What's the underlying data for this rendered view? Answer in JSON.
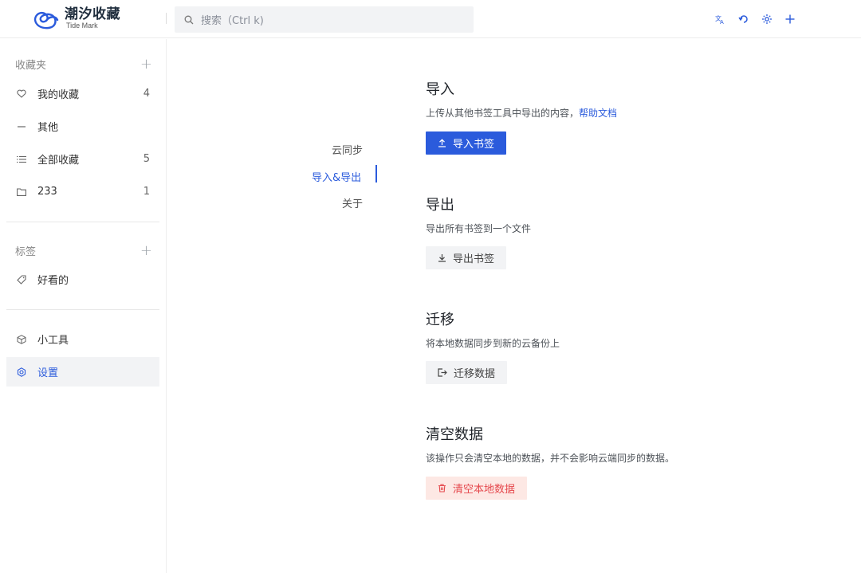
{
  "app": {
    "title": "潮汐收藏",
    "subtitle": "Tide Mark"
  },
  "search": {
    "placeholder": "搜索（Ctrl k)"
  },
  "sidebar": {
    "favorites_title": "收藏夹",
    "favorites": [
      {
        "label": "我的收藏",
        "count": "4",
        "icon": "heart-icon"
      },
      {
        "label": "其他",
        "count": "",
        "icon": "dash-icon"
      },
      {
        "label": "全部收藏",
        "count": "5",
        "icon": "list-icon"
      },
      {
        "label": "233",
        "count": "1",
        "icon": "folder-icon"
      }
    ],
    "tags_title": "标签",
    "tags": [
      {
        "label": "好看的",
        "icon": "tag-icon"
      }
    ],
    "tools": [
      {
        "label": "小工具",
        "icon": "cube-icon"
      },
      {
        "label": "设置",
        "icon": "settings-icon",
        "active": true
      }
    ]
  },
  "settings_nav": {
    "items": [
      "云同步",
      "导入&导出",
      "关于"
    ],
    "active": "导入&导出"
  },
  "sections": {
    "import": {
      "title": "导入",
      "desc": "上传从其他书签工具中导出的内容，",
      "link": "帮助文档",
      "button": "导入书签"
    },
    "export": {
      "title": "导出",
      "desc": "导出所有书签到一个文件",
      "button": "导出书签"
    },
    "migrate": {
      "title": "迁移",
      "desc": "将本地数据同步到新的云备份上",
      "button": "迁移数据"
    },
    "clear": {
      "title": "清空数据",
      "desc": "该操作只会清空本地的数据，并不会影响云端同步的数据。",
      "button": "清空本地数据"
    }
  },
  "colors": {
    "accent": "#2b5bdc",
    "danger": "#e5484d",
    "danger_bg": "#fde8e4"
  }
}
